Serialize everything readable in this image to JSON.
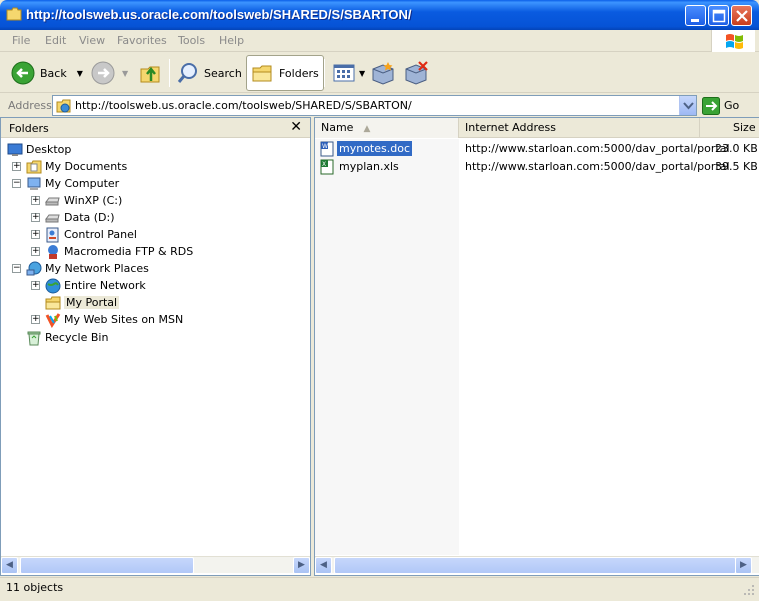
{
  "window": {
    "title": "http://toolsweb.us.oracle.com/toolsweb/SHARED/S/SBARTON/"
  },
  "menu": {
    "items": [
      "File",
      "Edit",
      "View",
      "Favorites",
      "Tools",
      "Help"
    ]
  },
  "toolbar": {
    "back_label": "Back",
    "search_label": "Search",
    "folders_label": "Folders"
  },
  "address": {
    "label": "Address",
    "value": "http://toolsweb.us.oracle.com/toolsweb/SHARED/S/SBARTON/",
    "go_label": "Go"
  },
  "folders_pane": {
    "title": "Folders",
    "close_glyph": "✕",
    "tree": [
      {
        "label": "Desktop",
        "icon": "desktop-icon",
        "expander": ""
      },
      {
        "label": "My Documents",
        "icon": "my-documents-icon",
        "expander": "+"
      },
      {
        "label": "My Computer",
        "icon": "my-computer-icon",
        "expander": "−"
      },
      {
        "label": "WinXP (C:)",
        "icon": "hard-drive-icon",
        "expander": "+"
      },
      {
        "label": "Data (D:)",
        "icon": "hard-drive-icon",
        "expander": "+"
      },
      {
        "label": "Control Panel",
        "icon": "control-panel-icon",
        "expander": "+"
      },
      {
        "label": "Macromedia FTP & RDS",
        "icon": "macromedia-icon",
        "expander": "+"
      },
      {
        "label": "My Network Places",
        "icon": "network-places-icon",
        "expander": "−"
      },
      {
        "label": "Entire Network",
        "icon": "globe-icon",
        "expander": "+"
      },
      {
        "label": "My Portal",
        "icon": "portal-folder-icon",
        "expander": ""
      },
      {
        "label": "My Web Sites on MSN",
        "icon": "msn-icon",
        "expander": "+"
      },
      {
        "label": "Recycle Bin",
        "icon": "recycle-bin-icon",
        "expander": ""
      }
    ]
  },
  "file_list": {
    "columns": [
      "Name",
      "Internet Address",
      "Size"
    ],
    "files": [
      {
        "name": "mynotes.doc",
        "url": "http://www.starloan.com:5000/dav_portal/portal",
        "size": "23.0 KB",
        "icon": "word-doc-icon",
        "selected": true
      },
      {
        "name": "myplan.xls",
        "url": "http://www.starloan.com:5000/dav_portal/portal",
        "size": "39.5 KB",
        "icon": "excel-xls-icon",
        "selected": false
      }
    ]
  },
  "status": {
    "text": "11 objects"
  },
  "colors": {
    "titlebar": "#0a5be0",
    "selection": "#316ac5",
    "chrome": "#ece9d8"
  }
}
